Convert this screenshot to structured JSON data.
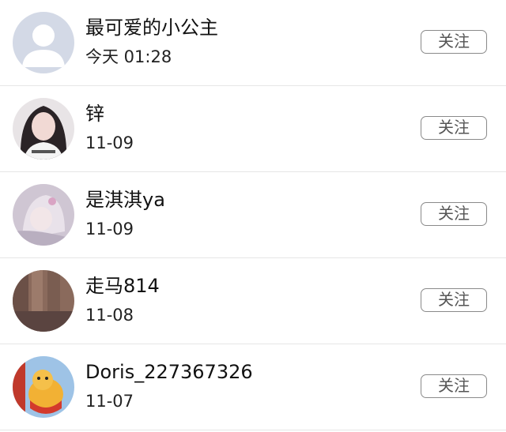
{
  "follow_label": "关注",
  "users": [
    {
      "name": "最可爱的小公主",
      "time": "今天 01:28",
      "avatar": "default-avatar-icon"
    },
    {
      "name": "锌",
      "time": "11-09",
      "avatar": "user-photo"
    },
    {
      "name": "是淇淇ya",
      "time": "11-09",
      "avatar": "user-photo"
    },
    {
      "name": "走马814",
      "time": "11-08",
      "avatar": "user-photo"
    },
    {
      "name": "Doris_227367326",
      "time": "11-07",
      "avatar": "user-photo"
    }
  ],
  "colors": {
    "divider": "#e6e6e6",
    "button_border": "#8a8a8a",
    "button_text": "#555555",
    "default_avatar_bg": "#d3d9e6"
  }
}
